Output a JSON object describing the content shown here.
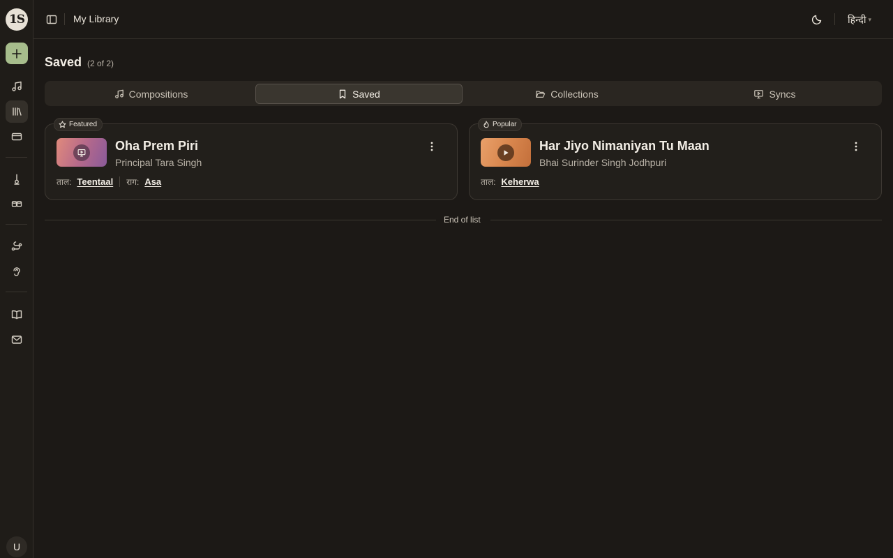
{
  "rail": {
    "logo_text": "1S",
    "new_label": "+",
    "avatar_initial": "U",
    "items": [
      {
        "name": "compositions",
        "icon": "music-note-icon"
      },
      {
        "name": "library",
        "icon": "library-icon",
        "active": true
      },
      {
        "name": "billing",
        "icon": "credit-card-icon"
      },
      {
        "name": "tuner",
        "icon": "tuner-icon"
      },
      {
        "name": "tabla",
        "icon": "drums-icon"
      },
      {
        "name": "sync",
        "icon": "route-icon"
      },
      {
        "name": "ear-training",
        "icon": "ear-icon"
      },
      {
        "name": "docs",
        "icon": "book-icon"
      },
      {
        "name": "contact",
        "icon": "mail-icon"
      }
    ]
  },
  "header": {
    "breadcrumb": "My Library",
    "language": "हिन्दी",
    "theme_icon": "moon-icon"
  },
  "page": {
    "title": "Saved",
    "count": "(2 of 2)"
  },
  "tabs": [
    {
      "label": "Compositions",
      "icon": "music-note-icon",
      "active": false
    },
    {
      "label": "Saved",
      "icon": "bookmark-icon",
      "active": true
    },
    {
      "label": "Collections",
      "icon": "folder-open-icon",
      "active": false
    },
    {
      "label": "Syncs",
      "icon": "monitor-play-icon",
      "active": false
    }
  ],
  "cards": [
    {
      "badge": "Featured",
      "badge_icon": "star-icon",
      "title": "Oha Prem Piri",
      "artist": "Principal Tara Singh",
      "thumb_icon": "monitor-play-icon",
      "meta": [
        {
          "label": "ताल:",
          "value": "Teentaal"
        },
        {
          "label": "राग:",
          "value": "Asa"
        }
      ]
    },
    {
      "badge": "Popular",
      "badge_icon": "flame-icon",
      "title": "Har Jiyo Nimaniyan Tu Maan",
      "artist": "Bhai Surinder Singh Jodhpuri",
      "thumb_icon": "play-icon",
      "meta": [
        {
          "label": "ताल:",
          "value": "Keherwa"
        }
      ]
    }
  ],
  "end_of_list": "End of list",
  "colors": {
    "background": "#1c1916",
    "accent_green": "#a7bd8c",
    "card_border": "#3d3832",
    "text_primary": "#f3eee6",
    "text_muted": "#b7b0a5"
  }
}
